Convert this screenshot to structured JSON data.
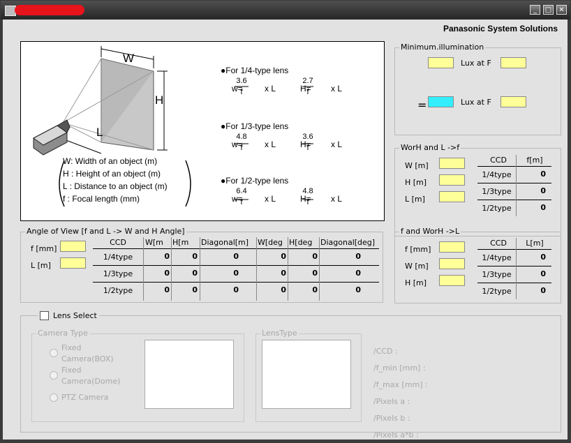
{
  "window": {
    "min": "_",
    "max": "□",
    "close": "✕"
  },
  "brand": "Panasonic System Solutions",
  "formula": {
    "legend": [
      "W: Width of an object (m)",
      "H : Height of an object (m)",
      "L : Distance to an object (m)",
      "f : Focal length (mm)"
    ],
    "diagram_labels": {
      "W": "W",
      "H": "H",
      "L": "L"
    },
    "lenses": [
      {
        "title": "●For 1/4-type lens",
        "w_num": "3.6",
        "h_num": "2.7"
      },
      {
        "title": "●For 1/3-type lens",
        "w_num": "4.8",
        "h_num": "3.6"
      },
      {
        "title": "●For 1/2-type lens",
        "w_num": "6.4",
        "h_num": "4.8"
      }
    ],
    "w_prefix": "w=",
    "h_prefix": "H=",
    "den": "f",
    "suffix": "x L"
  },
  "min_illum": {
    "title": "Minimum.illumination",
    "lux_at_f": "Lux at F",
    "equals": "="
  },
  "worh_f": {
    "title": "WorH and L ->f",
    "inputs": [
      "W [m]",
      "H [m]",
      "L [m]"
    ],
    "headers": [
      "CCD",
      "f[m]"
    ],
    "rows": [
      [
        "1/4type",
        "0"
      ],
      [
        "1/3type",
        "0"
      ],
      [
        "1/2type",
        "0"
      ]
    ]
  },
  "angle": {
    "title": "Angle of View [f and L -> W and H Angle]",
    "inputs": [
      "f [mm]",
      "L [m]"
    ],
    "headers": [
      "CCD",
      "W[m",
      "H[m",
      "Diagonal[m]",
      "W[deg",
      "H[deg",
      "Diagonal[deg]"
    ],
    "rows": [
      [
        "1/4type",
        "0",
        "0",
        "0",
        "0",
        "0",
        "0"
      ],
      [
        "1/3type",
        "0",
        "0",
        "0",
        "0",
        "0",
        "0"
      ],
      [
        "1/2type",
        "0",
        "0",
        "0",
        "0",
        "0",
        "0"
      ]
    ]
  },
  "f_worh": {
    "title": "f and WorH ->L",
    "inputs": [
      "f [mm]",
      "W [m]",
      "H [m]"
    ],
    "headers": [
      "CCD",
      "L[m]"
    ],
    "rows": [
      [
        "1/4type",
        "0"
      ],
      [
        "1/3type",
        "0"
      ],
      [
        "1/2type",
        "0"
      ]
    ]
  },
  "lens_select": {
    "label": "Lens Select",
    "camera_type": {
      "title": "Camera Type",
      "options": [
        "Fixed Camera(BOX)",
        "Fixed Camera(Dome)",
        "PTZ Camera"
      ]
    },
    "lens_type": {
      "title": "LensType"
    },
    "info": [
      "/CCD         :",
      "/f_min [mm]  :",
      "/f_max [mm]  :",
      "/Pixels a     :",
      "/Pixels b     :",
      "/Pixels a*b  :"
    ]
  },
  "colors": {
    "input_yellow": "#ffff99",
    "input_cyan": "#33eeff",
    "title_blot": "#e8141c"
  }
}
